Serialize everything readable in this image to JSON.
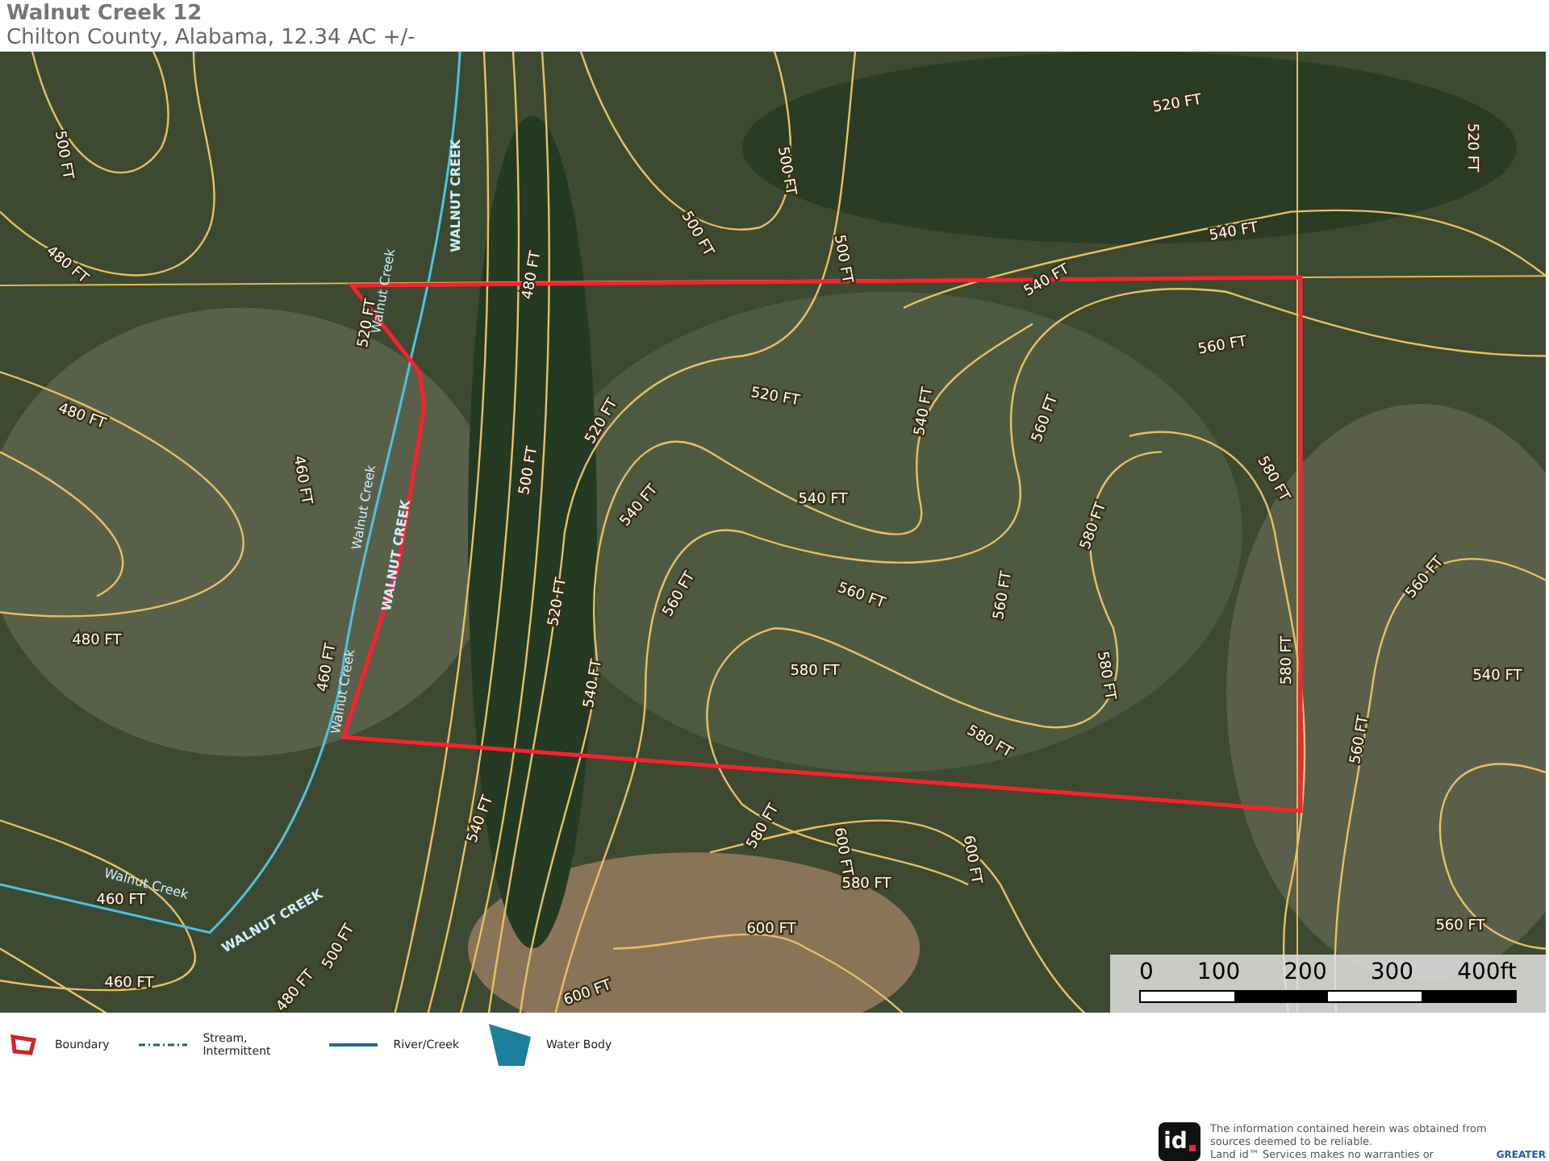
{
  "header": {
    "title": "Walnut Creek 12",
    "subtitle": "Chilton County, Alabama, 12.34 AC +/-"
  },
  "map": {
    "contour_labels": [
      "520 FT",
      "520 FT",
      "500 FT",
      "500 FT",
      "500 FT",
      "480 FT",
      "540 FT",
      "540 FT",
      "560 FT",
      "520 FT",
      "540 FT",
      "560 FT",
      "500 FT",
      "520 FT",
      "480 FT",
      "540 FT",
      "540 FT",
      "580 FT",
      "580 FT",
      "560 FT",
      "560 FT",
      "560 FT",
      "520 FT",
      "580 FT",
      "540 FT",
      "580 FT",
      "580 FT",
      "460 FT",
      "480 FT",
      "460 FT",
      "560 FT",
      "540 FT",
      "560 FT",
      "580 FT",
      "580 FT",
      "600 FT",
      "600 FT",
      "580 FT",
      "460 FT",
      "460 FT",
      "560 FT",
      "520 FT",
      "500 FT",
      "480 FT",
      "540 FT",
      "600 FT",
      "600 FT",
      "480 FT",
      "500 FT"
    ],
    "creek_labels": [
      "WALNUT CREEK",
      "Walnut Creek",
      "Walnut Creek",
      "WALNUT CREEK",
      "Walnut Creek",
      "Walnut Creek",
      "WALNUT CREEK"
    ],
    "scale_bar": {
      "ticks": [
        "0",
        "100",
        "200",
        "300",
        "400ft"
      ]
    }
  },
  "legend": [
    {
      "kind": "boundary",
      "label": "Boundary"
    },
    {
      "kind": "stream",
      "label": "Stream, Intermittent"
    },
    {
      "kind": "river",
      "label": "River/Creek"
    },
    {
      "kind": "water",
      "label": "Water Body"
    }
  ],
  "footer": {
    "logo": "id",
    "disclaimer": [
      "The information contained herein was obtained from",
      "sources deemed to be reliable.",
      "Land id™ Services makes no warranties or"
    ],
    "partner_logo": "GREATER"
  }
}
